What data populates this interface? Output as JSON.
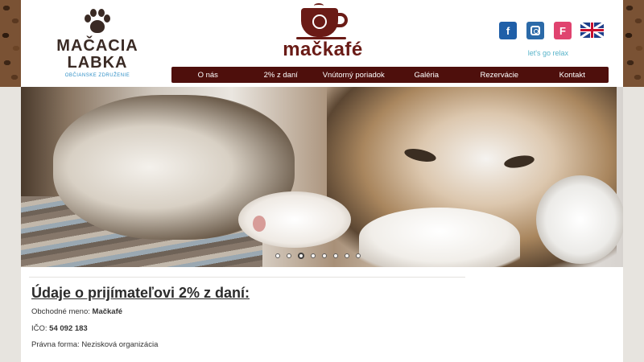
{
  "header": {
    "left_logo": {
      "line1": "MAČACIA",
      "line2": "LABKA",
      "subtitle": "OBČIANSKE ZDRUŽENIE"
    },
    "brand": "mačkafé",
    "tagline": "let's go relax",
    "social": [
      {
        "icon": "facebook-icon",
        "glyph": "f",
        "color": "#1f5fa8"
      },
      {
        "icon": "instagram-icon",
        "glyph": "",
        "color": "#2b6aa8"
      },
      {
        "icon": "foursquare-icon",
        "glyph": "F",
        "color": "#e0436f"
      }
    ],
    "language_flag": "english-flag-icon"
  },
  "nav": {
    "items": [
      "O nás",
      "2% z daní",
      "Vnútorný poriadok",
      "Galéria",
      "Rezervácie",
      "Kontakt"
    ]
  },
  "slider": {
    "total": 8,
    "active_index": 2
  },
  "content": {
    "title": "Údaje o prijímateľovi 2% z daní:",
    "business_name_label": "Obchodné meno:",
    "business_name_value": "Mačkafé",
    "ico_label": "IČO:",
    "ico_value": "54 092 183",
    "legal_form_label": "Právna forma:",
    "legal_form_value": "Nezisková organizácia"
  },
  "colors": {
    "brand_brown": "#6a1b16",
    "nav_bg": "#4e0f0c",
    "tagline": "#57b3c9"
  }
}
